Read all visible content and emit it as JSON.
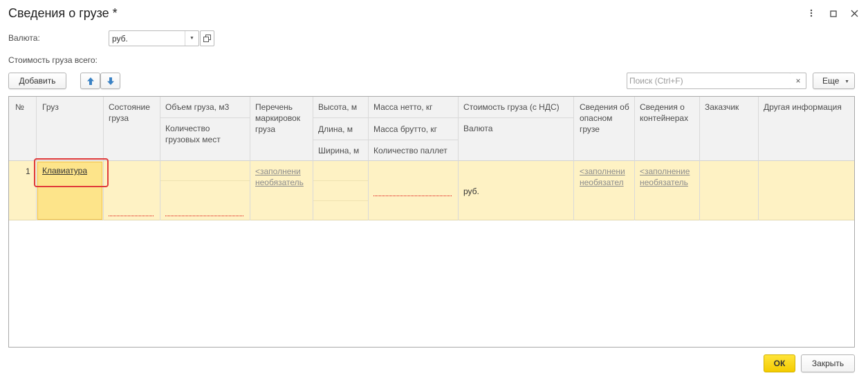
{
  "window": {
    "title": "Сведения о грузе *",
    "menu_icon": "more-vertical-icon",
    "maximize_icon": "maximize-icon",
    "close_icon": "close-icon"
  },
  "form": {
    "currency_label": "Валюта:",
    "currency_value": "руб.",
    "total_cost_label": "Стоимость груза всего:"
  },
  "toolbar": {
    "add_label": "Добавить",
    "up_icon": "arrow-up-icon",
    "down_icon": "arrow-down-icon",
    "search_placeholder": "Поиск (Ctrl+F)",
    "clear_label": "×",
    "more_label": "Еще"
  },
  "table": {
    "headers": {
      "num": "№",
      "cargo": "Груз",
      "state": "Состояние груза",
      "volume": "Объем груза, м3",
      "places": "Количество грузовых мест",
      "markings": "Перечень маркировок груза",
      "height": "Высота, м",
      "length": "Длина, м",
      "width": "Ширина, м",
      "net_mass": "Масса нетто, кг",
      "gross_mass": "Масса брутто, кг",
      "pallets": "Количество паллет",
      "cost": "Стоимость груза (с НДС)",
      "currency": "Валюта",
      "dangerous": "Сведения об опасном грузе",
      "containers": "Сведения о контейнерах",
      "customer": "Заказчик",
      "other": "Другая информация"
    },
    "rows": [
      {
        "num": "1",
        "cargo": "Клавиатура",
        "markings_1": "<заполнени",
        "markings_2": "необязатель",
        "currency": "руб.",
        "dangerous_1": "<заполнени",
        "dangerous_2": "необязател",
        "containers_1": "<заполнение",
        "containers_2": "необязатель"
      }
    ]
  },
  "footer": {
    "ok_label": "ОК",
    "close_label": "Закрыть"
  },
  "colors": {
    "row_selected": "#fef2c4",
    "active_cell": "#fde48a",
    "highlight_border": "#e03a3a",
    "ok_button": "#f4cc00",
    "arrow_blue": "#3b82c4"
  }
}
